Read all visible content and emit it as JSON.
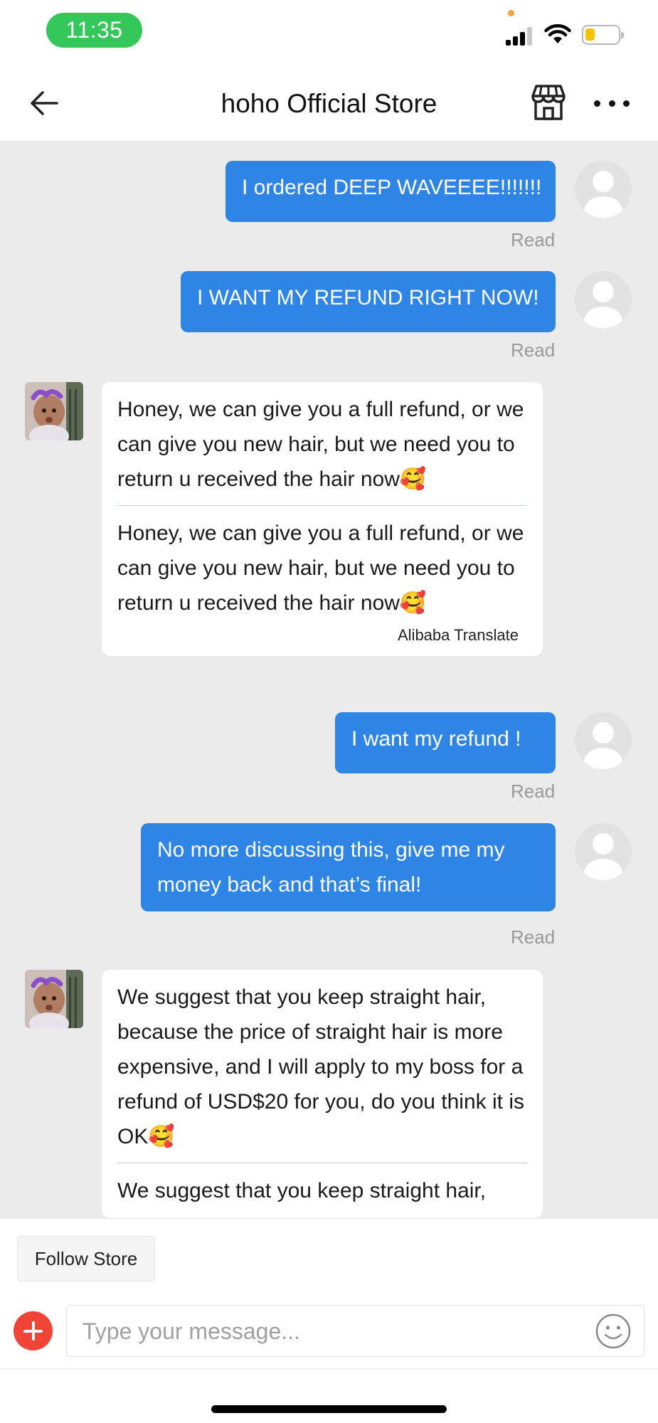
{
  "status_bar": {
    "time": "11:35",
    "battery_level": 0.3,
    "battery_color": "#f5c400",
    "time_pill_color": "#34c759"
  },
  "header": {
    "title": "hoho Official Store",
    "back_icon": "arrow-left-icon",
    "store_icon": "storefront-icon",
    "more_icon": "more-dots-icon"
  },
  "messages": [
    {
      "from": "me",
      "text": "I ordered DEEP WAVEEEE!!!!!!!",
      "status": "Read"
    },
    {
      "from": "me",
      "text": "I WANT MY REFUND RIGHT NOW!",
      "status": "Read"
    },
    {
      "from": "store",
      "text": "Honey, we can give you a full refund, or we can give you new hair, but we need you to return u received the hair now🥰",
      "translation": "Honey, we can give you a full refund, or we can give you new hair, but we need you to return u received the hair now🥰",
      "translation_label": "Alibaba Translate"
    },
    {
      "from": "me",
      "text": "I want my refund !",
      "status": "Read"
    },
    {
      "from": "me",
      "text": "No more discussing this, give me my money back and that’s final!",
      "status": "Read"
    },
    {
      "from": "store",
      "text": "We suggest that you keep straight hair, because the price of straight hair is more expensive, and I will apply to my boss for a refund of USD$20 for you, do you think it is OK🥰",
      "translation": "We suggest that you keep straight hair,"
    }
  ],
  "bottom": {
    "follow_label": "Follow Store",
    "input_placeholder": "Type your message...",
    "plus_icon": "plus-circle-icon",
    "emoji_icon": "smiley-icon"
  },
  "colors": {
    "outgoing_bubble": "#2f85e6",
    "chat_background": "#ebebeb",
    "add_button": "#f04437"
  }
}
